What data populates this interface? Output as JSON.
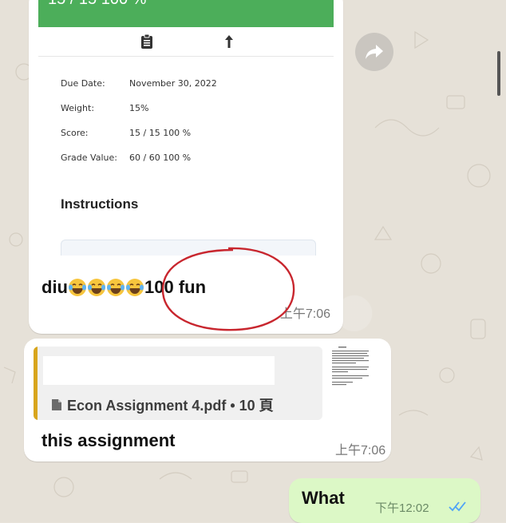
{
  "message1": {
    "screenshot": {
      "top_bar_text": "15 / 15    100 %",
      "details": [
        {
          "label": "Due Date:",
          "value": "November 30, 2022"
        },
        {
          "label": "Weight:",
          "value": "15%"
        },
        {
          "label": "Score:",
          "value": "15 / 15   100 %"
        },
        {
          "label": "Grade Value:",
          "value": "60 / 60   100 %"
        }
      ],
      "instructions_heading": "Instructions",
      "icons": [
        "clipboard-icon",
        "up-arrow-icon"
      ]
    },
    "caption_prefix": "diu",
    "emoji_count": 4,
    "caption_suffix": "100 fun",
    "time": "上午7:06"
  },
  "message2": {
    "document_title": "Econ Assignment 4.pdf • 10 頁",
    "text": "this assignment",
    "time": "上午7:06"
  },
  "message3": {
    "text": "What",
    "time": "下午12:02"
  },
  "colors": {
    "incoming_bubble": "#ffffff",
    "outgoing_bubble": "#dcf8c6",
    "shot_green_bar": "#4cae5a",
    "doc_accent": "#d8a51c",
    "annotation_circle": "#c8262e",
    "read_ticks": "#4fa3f7"
  }
}
